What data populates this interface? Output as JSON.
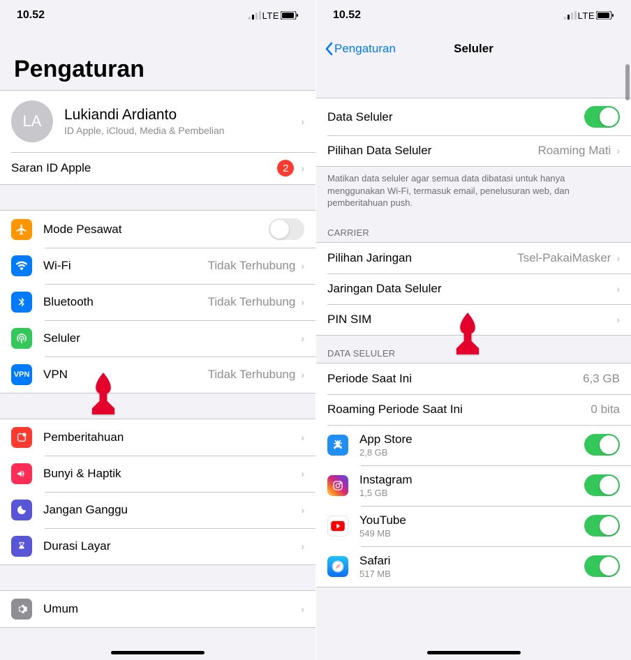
{
  "status": {
    "time": "10.52",
    "network": "LTE"
  },
  "left": {
    "title": "Pengaturan",
    "profile": {
      "initials": "LA",
      "name": "Lukiandi Ardianto",
      "sub": "ID Apple, iCloud, Media & Pembelian"
    },
    "appleSuggest": {
      "label": "Saran ID Apple",
      "badge": "2"
    },
    "rows": {
      "airplane": "Mode Pesawat",
      "wifi": "Wi-Fi",
      "wifi_detail": "Tidak Terhubung",
      "bluetooth": "Bluetooth",
      "bluetooth_detail": "Tidak Terhubung",
      "cellular": "Seluler",
      "vpn": "VPN",
      "vpn_detail": "Tidak Terhubung",
      "notifications": "Pemberitahuan",
      "sounds": "Bunyi & Haptik",
      "dnd": "Jangan Ganggu",
      "screentime": "Durasi Layar",
      "general": "Umum"
    }
  },
  "right": {
    "back": "Pengaturan",
    "title": "Seluler",
    "rows": {
      "cellular_data": "Data Seluler",
      "data_options": "Pilihan Data Seluler",
      "data_options_detail": "Roaming Mati",
      "footer": "Matikan data seluler agar semua data dibatasi untuk hanya menggunakan Wi-Fi, termasuk email, penelusuran web, dan pemberitahuan push.",
      "carrier_header": "CARRIER",
      "network_sel": "Pilihan Jaringan",
      "network_sel_detail": "Tsel-PakaiMasker",
      "data_network": "Jaringan Data Seluler",
      "sim_pin": "PIN SIM",
      "data_header": "DATA SELULER",
      "period": "Periode Saat Ini",
      "period_val": "6,3 GB",
      "roam_period": "Roaming Periode Saat Ini",
      "roam_period_val": "0 bita"
    },
    "apps": [
      {
        "name": "App Store",
        "size": "2,8 GB",
        "icon": "appstore"
      },
      {
        "name": "Instagram",
        "size": "1,5 GB",
        "icon": "instagram"
      },
      {
        "name": "YouTube",
        "size": "549 MB",
        "icon": "youtube"
      },
      {
        "name": "Safari",
        "size": "517 MB",
        "icon": "safari"
      }
    ]
  }
}
